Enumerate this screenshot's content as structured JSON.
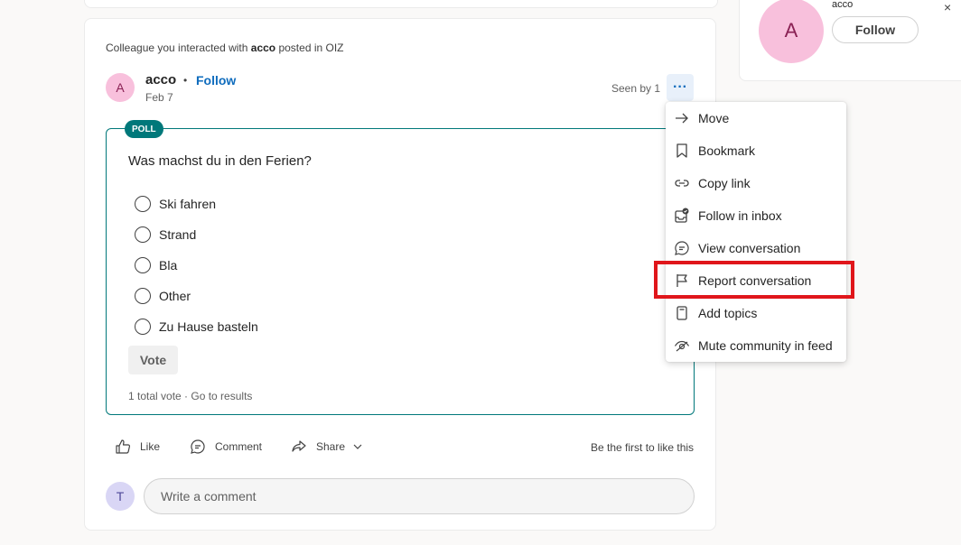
{
  "side_profile": {
    "avatar_letter": "A",
    "name": "acco",
    "follow_label": "Follow",
    "close_glyph": "×"
  },
  "post": {
    "context_prefix": "Colleague you interacted with ",
    "context_user": "acco",
    "context_suffix": " posted in OIZ",
    "author_avatar_letter": "A",
    "author": "acco",
    "separator": "•",
    "follow_label": "Follow",
    "date": "Feb 7",
    "seen_by": "Seen by 1",
    "more_glyph": "···"
  },
  "poll": {
    "badge": "POLL",
    "question": "Was machst du in den Ferien?",
    "options": [
      "Ski fahren",
      "Strand",
      "Bla",
      "Other",
      "Zu Hause basteln"
    ],
    "vote_label": "Vote",
    "summary": "1 total vote · Go to results"
  },
  "actions": {
    "like": "Like",
    "comment": "Comment",
    "share": "Share",
    "be_first": "Be the first to like this"
  },
  "comment_box": {
    "avatar_letter": "T",
    "placeholder": "Write a comment"
  },
  "menu": {
    "items": [
      {
        "label": "Move",
        "icon": "arrow-right-icon"
      },
      {
        "label": "Bookmark",
        "icon": "bookmark-icon"
      },
      {
        "label": "Copy link",
        "icon": "link-icon"
      },
      {
        "label": "Follow in inbox",
        "icon": "inbox-follow-icon"
      },
      {
        "label": "View conversation",
        "icon": "conversation-icon"
      },
      {
        "label": "Report conversation",
        "icon": "flag-icon"
      },
      {
        "label": "Add topics",
        "icon": "topic-icon"
      },
      {
        "label": "Mute community in feed",
        "icon": "eye-off-icon"
      }
    ],
    "highlighted_item": "Report conversation"
  },
  "colors": {
    "accent": "#0f6cbd",
    "poll_teal": "#00787a",
    "highlight_red": "#e0161b",
    "avatar_pink": "#f8c0dc"
  }
}
